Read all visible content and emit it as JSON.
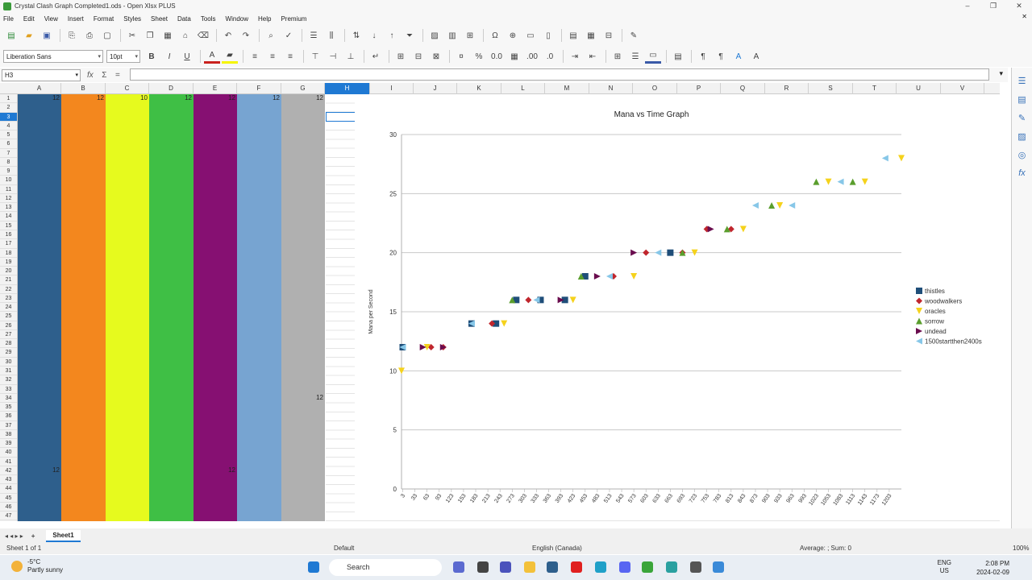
{
  "window": {
    "title": "Crystal Clash Graph Completed1.ods - Open Xlsx PLUS",
    "minimize": "–",
    "maximize": "❐",
    "close": "✕",
    "close_doc": "✕"
  },
  "menu": [
    "File",
    "Edit",
    "View",
    "Insert",
    "Format",
    "Styles",
    "Sheet",
    "Data",
    "Tools",
    "Window",
    "Help",
    "Premium"
  ],
  "toolbar2": {
    "font_name": "Liberation Sans",
    "font_size": "10pt"
  },
  "formula_bar": {
    "name_box": "H3",
    "formula": ""
  },
  "columns": [
    "A",
    "B",
    "C",
    "D",
    "E",
    "F",
    "G",
    "H",
    "I",
    "J",
    "K",
    "L",
    "M",
    "N",
    "O",
    "P",
    "Q",
    "R",
    "S",
    "T",
    "U",
    "V"
  ],
  "selected_column": "H",
  "rows": [
    "1",
    "2",
    "3",
    "4",
    "5",
    "6",
    "7",
    "8",
    "9",
    "10",
    "11",
    "12",
    "13",
    "14",
    "15",
    "16",
    "17",
    "18",
    "19",
    "20",
    "21",
    "22",
    "23",
    "24",
    "25",
    "26",
    "27",
    "28",
    "29",
    "30",
    "31",
    "32",
    "33",
    "34",
    "35",
    "36",
    "37",
    "38",
    "39",
    "40",
    "41",
    "42",
    "43",
    "44",
    "45",
    "46",
    "47"
  ],
  "selected_row": "3",
  "cells": {
    "A1": "12",
    "B1": "12",
    "C1": "10",
    "D1": "12",
    "E1": "12",
    "F1": "12",
    "G1": "12",
    "G34": "12",
    "A42": "12",
    "E42": "12"
  },
  "column_colors": {
    "A": "#2e5f8c",
    "B": "#f3871e",
    "C": "#e6fa1e",
    "D": "#3fbf45",
    "E": "#861072",
    "F": "#77a4d1",
    "G": "#b0b0b0"
  },
  "chart_data": {
    "type": "scatter",
    "title": "Mana vs Time Graph",
    "xlabel": "",
    "ylabel": "Mana per Second",
    "ylim": [
      0,
      30
    ],
    "yticks": [
      0,
      5,
      10,
      15,
      20,
      25,
      30
    ],
    "x_tick_labels": [
      "3",
      "33",
      "63",
      "93",
      "123",
      "153",
      "183",
      "213",
      "243",
      "273",
      "303",
      "333",
      "363",
      "393",
      "423",
      "453",
      "483",
      "513",
      "543",
      "573",
      "603",
      "633",
      "663",
      "693",
      "723",
      "753",
      "783",
      "813",
      "843",
      "873",
      "903",
      "933",
      "963",
      "993",
      "1023",
      "1053",
      "1083",
      "1113",
      "1143",
      "1173",
      "1203"
    ],
    "xlim": [
      0,
      1233
    ],
    "grid": "horizontal",
    "legend_position": "right",
    "series": [
      {
        "name": "thistles",
        "marker": "square",
        "color": "#1f4e79",
        "points": [
          [
            3,
            12
          ],
          [
            173,
            14
          ],
          [
            233,
            14
          ],
          [
            283,
            16
          ],
          [
            343,
            16
          ],
          [
            403,
            16
          ],
          [
            453,
            18
          ],
          [
            663,
            20
          ]
        ]
      },
      {
        "name": "woodwalkers",
        "marker": "diamond",
        "color": "#c0262d",
        "points": [
          [
            73,
            12
          ],
          [
            103,
            12
          ],
          [
            223,
            14
          ],
          [
            313,
            16
          ],
          [
            523,
            18
          ],
          [
            603,
            20
          ],
          [
            693,
            20
          ],
          [
            753,
            22
          ],
          [
            813,
            22
          ]
        ]
      },
      {
        "name": "oracles",
        "marker": "triangle-down",
        "color": "#f5d21c",
        "points": [
          [
            0,
            10
          ],
          [
            63,
            12
          ],
          [
            253,
            14
          ],
          [
            423,
            16
          ],
          [
            573,
            18
          ],
          [
            723,
            20
          ],
          [
            843,
            22
          ],
          [
            933,
            24
          ],
          [
            1053,
            26
          ],
          [
            1143,
            26
          ],
          [
            1233,
            28
          ]
        ]
      },
      {
        "name": "sorrow",
        "marker": "triangle-up",
        "color": "#5a9e2d",
        "points": [
          [
            273,
            16
          ],
          [
            443,
            18
          ],
          [
            693,
            20
          ],
          [
            803,
            22
          ],
          [
            913,
            24
          ],
          [
            1023,
            26
          ],
          [
            1113,
            26
          ]
        ]
      },
      {
        "name": "undead",
        "marker": "triangle-right",
        "color": "#6a0d4e",
        "points": [
          [
            53,
            12
          ],
          [
            103,
            12
          ],
          [
            393,
            16
          ],
          [
            483,
            18
          ],
          [
            573,
            20
          ],
          [
            763,
            22
          ]
        ]
      },
      {
        "name": "1500startthen2400s",
        "marker": "triangle-left",
        "color": "#87c7e8",
        "points": [
          [
            3,
            12
          ],
          [
            173,
            14
          ],
          [
            333,
            16
          ],
          [
            513,
            18
          ],
          [
            633,
            20
          ],
          [
            873,
            24
          ],
          [
            963,
            24
          ],
          [
            1083,
            26
          ],
          [
            1193,
            28
          ]
        ]
      }
    ]
  },
  "sheet_tabs": {
    "nav": "◂ ◂ ▸ ▸",
    "add": "+",
    "active": "Sheet1"
  },
  "status": {
    "sheet_pos": "Sheet 1 of 1",
    "page_style": "Default",
    "language": "English (Canada)",
    "summary": "Average: ; Sum: 0",
    "zoom": "100%"
  },
  "taskbar": {
    "weather_temp": "-5°C",
    "weather_desc": "Partly sunny",
    "search": "Search",
    "lang1": "ENG",
    "lang2": "US",
    "time": "2:08 PM",
    "date": "2024-02-09"
  }
}
